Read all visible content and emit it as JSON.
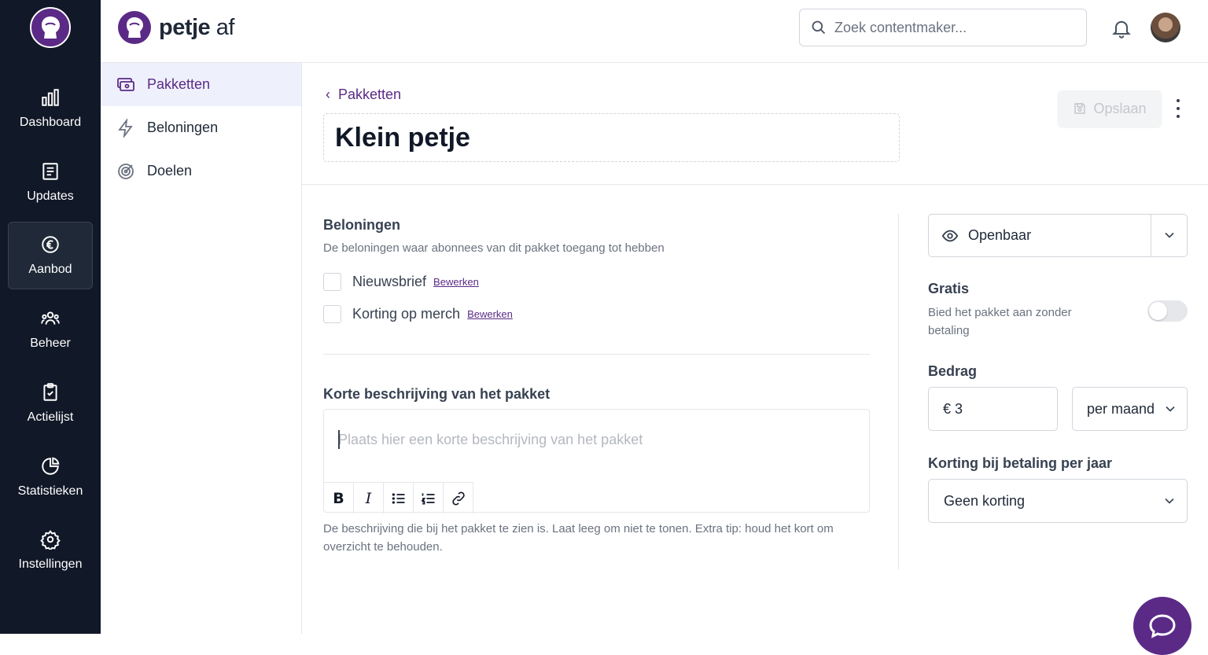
{
  "rail": {
    "items": [
      {
        "label": "Dashboard",
        "icon": "bar-chart-icon"
      },
      {
        "label": "Updates",
        "icon": "newspaper-icon"
      },
      {
        "label": "Aanbod",
        "icon": "euro-icon",
        "active": true
      },
      {
        "label": "Beheer",
        "icon": "users-icon"
      },
      {
        "label": "Actielijst",
        "icon": "clipboard-check-icon"
      },
      {
        "label": "Statistieken",
        "icon": "pie-chart-icon"
      },
      {
        "label": "Instellingen",
        "icon": "gear-icon"
      }
    ]
  },
  "header": {
    "brand_bold": "petje",
    "brand_light": "af",
    "search_placeholder": "Zoek contentmaker..."
  },
  "subnav": {
    "items": [
      {
        "label": "Pakketten",
        "icon": "packages-icon",
        "active": true
      },
      {
        "label": "Beloningen",
        "icon": "lightning-icon"
      },
      {
        "label": "Doelen",
        "icon": "target-icon"
      }
    ]
  },
  "page": {
    "back_label": "Pakketten",
    "title": "Klein petje",
    "save_label": "Opslaan"
  },
  "rewards": {
    "title": "Beloningen",
    "help": "De beloningen waar abonnees van dit pakket toegang tot hebben",
    "edit_label": "Bewerken",
    "items": [
      {
        "label": "Nieuwsbrief",
        "checked": false
      },
      {
        "label": "Korting op merch",
        "checked": false
      }
    ]
  },
  "description": {
    "title": "Korte beschrijving van het pakket",
    "placeholder": "Plaats hier een korte beschrijving van het pakket",
    "help": "De beschrijving die bij het pakket te zien is. Laat leeg om niet te tonen. Extra tip: houd het kort om overzicht te behouden.",
    "toolbar": [
      "bold",
      "italic",
      "bullet-list",
      "numbered-list",
      "link"
    ]
  },
  "settings": {
    "visibility": "Openbaar",
    "gratis_title": "Gratis",
    "gratis_help": "Bied het pakket aan zonder betaling",
    "gratis_on": false,
    "amount_title": "Bedrag",
    "amount_value": "€ 3",
    "period_value": "per maand",
    "discount_title": "Korting bij betaling per jaar",
    "discount_value": "Geen korting"
  },
  "colors": {
    "brand": "#5b2a86",
    "rail": "#111827",
    "active_subnav": "#eef0fb"
  }
}
